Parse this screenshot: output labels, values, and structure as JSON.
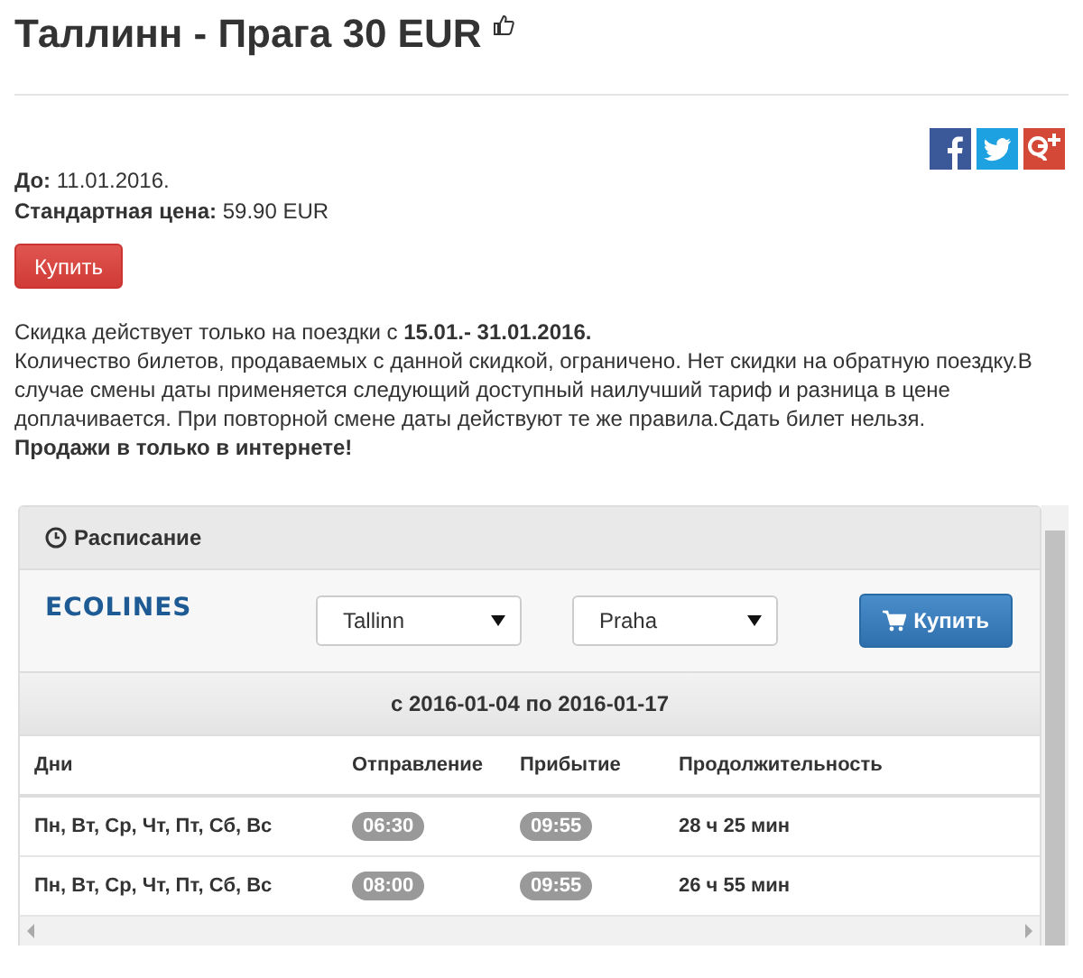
{
  "title": "Таллинн - Прага 30 EUR",
  "details": [
    {
      "label": "До:",
      "value": "11.01.2016."
    },
    {
      "label": "Стандартная цена:",
      "value": "59.90 EUR"
    }
  ],
  "buy_button": "Купить",
  "description": [
    "Скидка действует только на поездки с **15.01.- 31.01.2016.**",
    "Количество билетов, продаваемых с данной скидкой, ограничено. Нет скидки на обратную поездку.В случае смены даты применяется следующий доступный наилучший тариф и разница в цене доплачивается. При повторной смене даты действуют те же правила.Сдать билет нельзя.",
    "**Продажи в только в интернете!**"
  ],
  "schedule": {
    "title": "Расписание",
    "logo": "ECOLINES",
    "from": "Tallinn",
    "to": "Praha",
    "buy_button": "Купить",
    "period": "с 2016-01-04 по 2016-01-17",
    "columns": [
      "Дни",
      "Отправление",
      "Прибытие",
      "Продолжительность"
    ],
    "rows": [
      {
        "days": "Пн, Вт, Ср, Чт, Пт, Сб, Вс",
        "departure": "06:30",
        "arrival": "09:55",
        "duration": "28 ч 25 мин"
      },
      {
        "days": "Пн, Вт, Ср, Чт, Пт, Сб, Вс",
        "departure": "08:00",
        "arrival": "09:55",
        "duration": "26 ч 55 мин"
      }
    ]
  }
}
